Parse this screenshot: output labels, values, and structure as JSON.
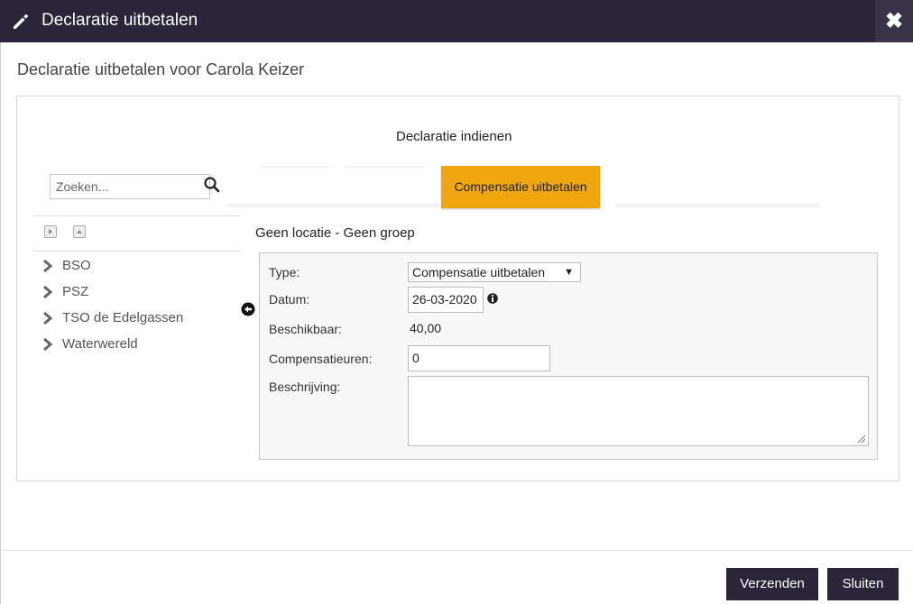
{
  "window": {
    "title": "Declaratie uitbetalen",
    "close_icon": "close-icon",
    "edit_icon": "pencil-icon"
  },
  "subtitle": "Declaratie uitbetalen voor Carola Keizer",
  "card": {
    "heading": "Declaratie indienen",
    "active_tab": "Compensatie uitbetalen",
    "accent_color": "#f0a70f"
  },
  "sidebar": {
    "search_placeholder": "Zoeken...",
    "tree_items": [
      "BSO",
      "PSZ",
      "TSO de Edelgassen",
      "Waterwereld"
    ]
  },
  "form": {
    "section_title": "Geen locatie - Geen groep",
    "type_label": "Type:",
    "type_value": "Compensatie uitbetalen",
    "date_label": "Datum:",
    "date_value": "26-03-2020",
    "available_label": "Beschikbaar:",
    "available_value": "40,00",
    "hours_label": "Compensatieuren:",
    "hours_value": "0",
    "description_label": "Beschrijving:",
    "description_value": ""
  },
  "footer": {
    "submit_label": "Verzenden",
    "close_label": "Sluiten"
  }
}
